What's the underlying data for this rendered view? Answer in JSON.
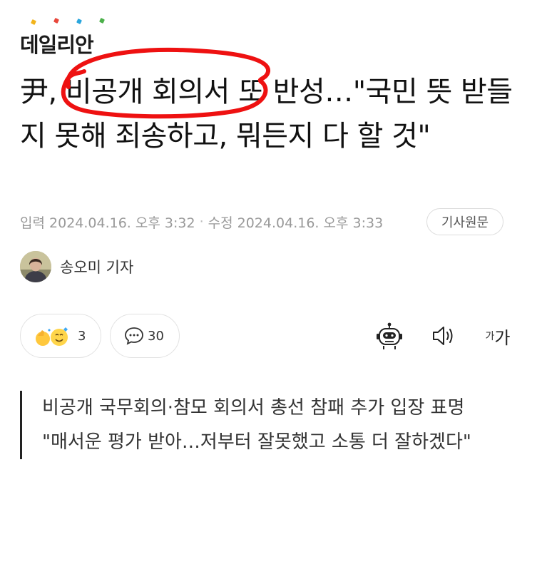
{
  "logo": {
    "text": "데일리안",
    "dot_colors": [
      "#f2b41c",
      "#e8473b",
      "#2aa6dd",
      "#4bb04a"
    ]
  },
  "headline": {
    "text": "尹, 비공개 회의서 또 반성…\"국민 뜻 받들지 못해 죄송하고, 뭐든지 다 할 것\"",
    "annotation_color": "#ee1111"
  },
  "meta": {
    "input_label": "입력",
    "input_time": "2024.04.16. 오후 3:32",
    "separator": "·",
    "edit_label": "수정",
    "edit_time": "2024.04.16. 오후 3:33",
    "original_button": "기사원문"
  },
  "reporter": {
    "name": "송오미 기자"
  },
  "reactions": {
    "count": "3",
    "icon": "reaction-faces-icon"
  },
  "comments": {
    "count": "30",
    "icon": "speech-bubble-icon"
  },
  "tools": {
    "bot_icon": "summary-bot-icon",
    "speaker_icon": "speaker-icon",
    "font_small": "가",
    "font_big": "가"
  },
  "summary": {
    "lines": [
      "비공개 국무회의·참모 회의서 총선 참패 추가 입장 표명",
      "\"매서운 평가 받아…저부터 잘못했고 소통 더 잘하겠다\""
    ]
  }
}
